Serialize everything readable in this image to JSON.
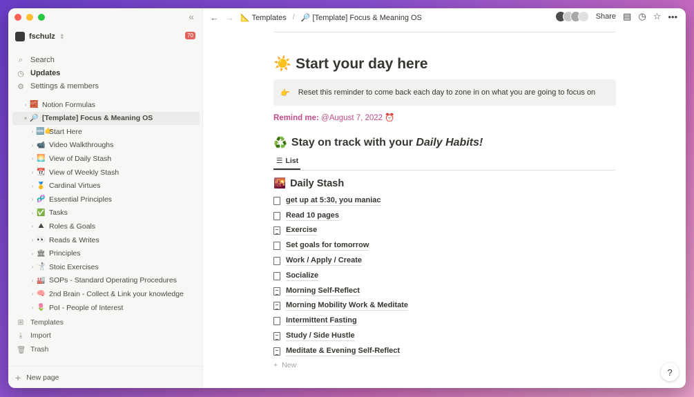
{
  "sidebar": {
    "workspace": {
      "name": "fschulz",
      "badge": "70"
    },
    "nav": [
      {
        "label": "Search",
        "icon": "🔍"
      },
      {
        "label": "Updates",
        "icon": "🕘"
      },
      {
        "label": "Settings & members",
        "icon": "⚙"
      }
    ],
    "tree": [
      {
        "label": "Notion Formulas",
        "emoji": "🧱",
        "level": 0
      },
      {
        "label": "[Template] Focus & Meaning OS",
        "emoji": "🔎",
        "level": 0,
        "open": true
      },
      {
        "label": "Start Here",
        "emoji": "🆕👉",
        "level": 1
      },
      {
        "label": "Video Walkthroughs",
        "emoji": "📹",
        "level": 1
      },
      {
        "label": "View of Daily Stash",
        "emoji": "🌅",
        "level": 1
      },
      {
        "label": "View of Weekly Stash",
        "emoji": "📆",
        "level": 1
      },
      {
        "label": "Cardinal Virtues",
        "emoji": "🥇",
        "level": 1
      },
      {
        "label": "Essential Principles",
        "emoji": "🧬",
        "level": 1
      },
      {
        "label": "Tasks",
        "emoji": "✅",
        "level": 1
      },
      {
        "label": "Roles & Goals",
        "emoji": "⛰",
        "level": 1
      },
      {
        "label": "Reads & Writes",
        "emoji": "👀",
        "level": 1
      },
      {
        "label": "Principles",
        "emoji": "🏛",
        "level": 1
      },
      {
        "label": "Stoic Exercises",
        "emoji": "🤺",
        "level": 1
      },
      {
        "label": "SOPs - Standard Operating Procedures",
        "emoji": "🏭",
        "level": 1
      },
      {
        "label": "2nd Brain - Collect & Link your knowledge",
        "emoji": "🧠",
        "level": 1
      },
      {
        "label": "PoI - People of Interest",
        "emoji": "🌷",
        "level": 1
      }
    ],
    "bottom": [
      {
        "label": "Templates",
        "icon": "⊞"
      },
      {
        "label": "Import",
        "icon": "⤓"
      },
      {
        "label": "Trash",
        "icon": "🗑"
      }
    ],
    "new_page": "New page"
  },
  "topbar": {
    "breadcrumb": [
      {
        "label": "Templates",
        "emoji": "📐"
      },
      {
        "label": "[Template] Focus & Meaning OS",
        "emoji": "🔎"
      }
    ],
    "share": "Share"
  },
  "page": {
    "title_emoji": "☀️",
    "title": "Start your day here",
    "callout_emoji": "👉",
    "callout": "Reset this reminder to come back each day to zone in on what you are going to focus on",
    "remind_label": "Remind me:",
    "remind_date": "@August 7, 2022",
    "habits_emoji": "♻️",
    "habits_title_a": "Stay on track with your ",
    "habits_title_b": "Daily Habits!",
    "view_tab": "List",
    "db_emoji": "🌇",
    "db_title": "Daily Stash",
    "items": [
      {
        "label": "get up at 5:30, you maniac",
        "lines": false
      },
      {
        "label": "Read 10 pages",
        "lines": false
      },
      {
        "label": "Exercise",
        "lines": true
      },
      {
        "label": "Set goals for tomorrow",
        "lines": false
      },
      {
        "label": "Work / Apply / Create",
        "lines": false
      },
      {
        "label": "Socialize",
        "lines": false
      },
      {
        "label": "Morning Self-Reflect",
        "lines": true
      },
      {
        "label": "Morning Mobility Work & Meditate",
        "lines": true
      },
      {
        "label": "Intermittent Fasting",
        "lines": false
      },
      {
        "label": "Study / Side Hustle",
        "lines": true
      },
      {
        "label": "Meditate & Evening Self-Reflect",
        "lines": true
      }
    ],
    "new_label": "New",
    "help": "?"
  }
}
